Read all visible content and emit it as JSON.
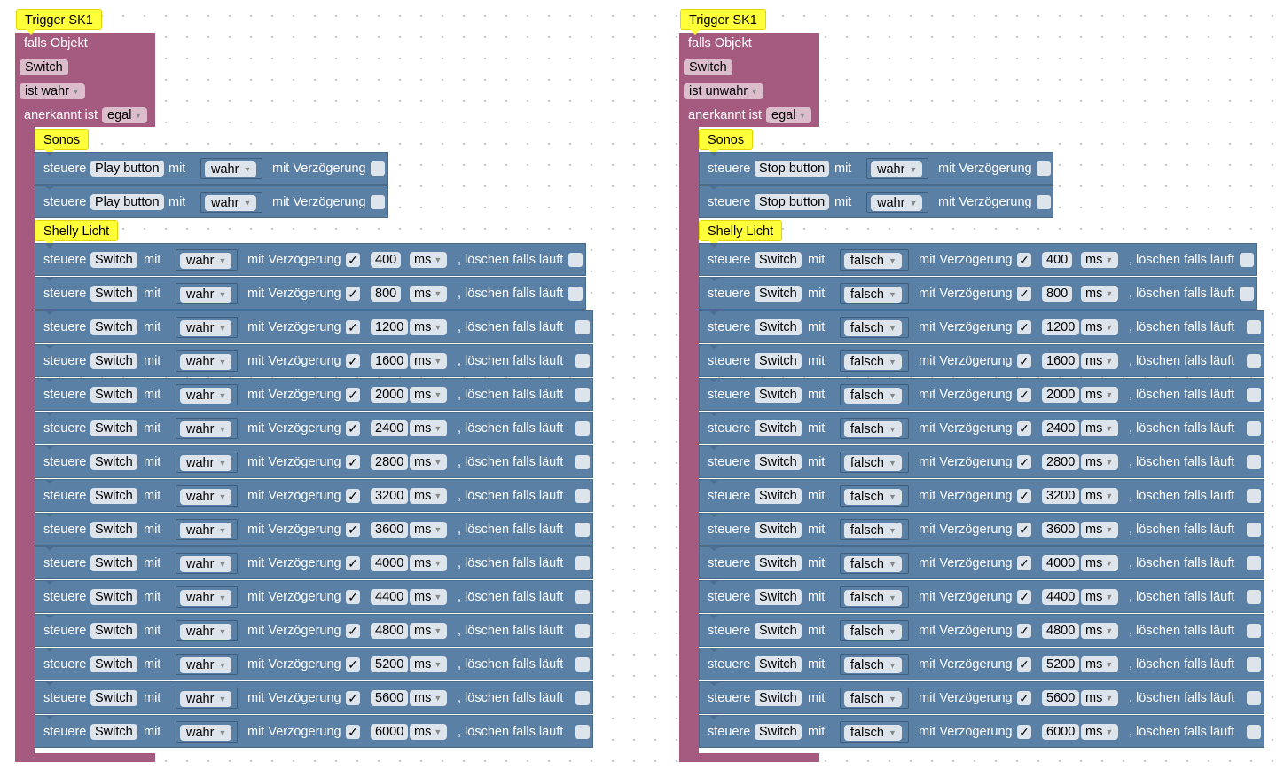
{
  "scripts": [
    {
      "trigger_comment": "Trigger SK1",
      "falls_label": "falls Objekt",
      "object": "Switch",
      "condition": "ist wahr",
      "ack_label": "anerkannt ist",
      "ack_value": "egal",
      "sonos_comment": "Sonos",
      "sonos_blocks": [
        {
          "steuere": "steuere",
          "target": "Play button",
          "mit": "mit",
          "value": "wahr",
          "delay_label": "mit Verzögerung",
          "checked": ""
        },
        {
          "steuere": "steuere",
          "target": "Play button",
          "mit": "mit",
          "value": "wahr",
          "delay_label": "mit Verzögerung",
          "checked": ""
        }
      ],
      "shelly_comment": "Shelly Licht",
      "shelly_blocks": [
        {
          "steuere": "steuere",
          "target": "Switch",
          "mit": "mit",
          "value": "wahr",
          "delay_label": "mit Verzögerung",
          "checked": "✓",
          "delay": "400",
          "unit": "ms",
          "clear_label": ", löschen falls läuft",
          "clear": ""
        },
        {
          "steuere": "steuere",
          "target": "Switch",
          "mit": "mit",
          "value": "wahr",
          "delay_label": "mit Verzögerung",
          "checked": "✓",
          "delay": "800",
          "unit": "ms",
          "clear_label": ", löschen falls läuft",
          "clear": ""
        },
        {
          "steuere": "steuere",
          "target": "Switch",
          "mit": "mit",
          "value": "wahr",
          "delay_label": "mit Verzögerung",
          "checked": "✓",
          "delay": "1200",
          "unit": "ms",
          "clear_label": ", löschen falls läuft",
          "clear": ""
        },
        {
          "steuere": "steuere",
          "target": "Switch",
          "mit": "mit",
          "value": "wahr",
          "delay_label": "mit Verzögerung",
          "checked": "✓",
          "delay": "1600",
          "unit": "ms",
          "clear_label": ", löschen falls läuft",
          "clear": ""
        },
        {
          "steuere": "steuere",
          "target": "Switch",
          "mit": "mit",
          "value": "wahr",
          "delay_label": "mit Verzögerung",
          "checked": "✓",
          "delay": "2000",
          "unit": "ms",
          "clear_label": ", löschen falls läuft",
          "clear": ""
        },
        {
          "steuere": "steuere",
          "target": "Switch",
          "mit": "mit",
          "value": "wahr",
          "delay_label": "mit Verzögerung",
          "checked": "✓",
          "delay": "2400",
          "unit": "ms",
          "clear_label": ", löschen falls läuft",
          "clear": ""
        },
        {
          "steuere": "steuere",
          "target": "Switch",
          "mit": "mit",
          "value": "wahr",
          "delay_label": "mit Verzögerung",
          "checked": "✓",
          "delay": "2800",
          "unit": "ms",
          "clear_label": ", löschen falls läuft",
          "clear": ""
        },
        {
          "steuere": "steuere",
          "target": "Switch",
          "mit": "mit",
          "value": "wahr",
          "delay_label": "mit Verzögerung",
          "checked": "✓",
          "delay": "3200",
          "unit": "ms",
          "clear_label": ", löschen falls läuft",
          "clear": ""
        },
        {
          "steuere": "steuere",
          "target": "Switch",
          "mit": "mit",
          "value": "wahr",
          "delay_label": "mit Verzögerung",
          "checked": "✓",
          "delay": "3600",
          "unit": "ms",
          "clear_label": ", löschen falls läuft",
          "clear": ""
        },
        {
          "steuere": "steuere",
          "target": "Switch",
          "mit": "mit",
          "value": "wahr",
          "delay_label": "mit Verzögerung",
          "checked": "✓",
          "delay": "4000",
          "unit": "ms",
          "clear_label": ", löschen falls läuft",
          "clear": ""
        },
        {
          "steuere": "steuere",
          "target": "Switch",
          "mit": "mit",
          "value": "wahr",
          "delay_label": "mit Verzögerung",
          "checked": "✓",
          "delay": "4400",
          "unit": "ms",
          "clear_label": ", löschen falls läuft",
          "clear": ""
        },
        {
          "steuere": "steuere",
          "target": "Switch",
          "mit": "mit",
          "value": "wahr",
          "delay_label": "mit Verzögerung",
          "checked": "✓",
          "delay": "4800",
          "unit": "ms",
          "clear_label": ", löschen falls läuft",
          "clear": ""
        },
        {
          "steuere": "steuere",
          "target": "Switch",
          "mit": "mit",
          "value": "wahr",
          "delay_label": "mit Verzögerung",
          "checked": "✓",
          "delay": "5200",
          "unit": "ms",
          "clear_label": ", löschen falls läuft",
          "clear": ""
        },
        {
          "steuere": "steuere",
          "target": "Switch",
          "mit": "mit",
          "value": "wahr",
          "delay_label": "mit Verzögerung",
          "checked": "✓",
          "delay": "5600",
          "unit": "ms",
          "clear_label": ", löschen falls läuft",
          "clear": ""
        },
        {
          "steuere": "steuere",
          "target": "Switch",
          "mit": "mit",
          "value": "wahr",
          "delay_label": "mit Verzögerung",
          "checked": "✓",
          "delay": "6000",
          "unit": "ms",
          "clear_label": ", löschen falls läuft",
          "clear": ""
        }
      ]
    },
    {
      "trigger_comment": "Trigger SK1",
      "falls_label": "falls Objekt",
      "object": "Switch",
      "condition": "ist unwahr",
      "ack_label": "anerkannt ist",
      "ack_value": "egal",
      "sonos_comment": "Sonos",
      "sonos_blocks": [
        {
          "steuere": "steuere",
          "target": "Stop button",
          "mit": "mit",
          "value": "wahr",
          "delay_label": "mit Verzögerung",
          "checked": ""
        },
        {
          "steuere": "steuere",
          "target": "Stop button",
          "mit": "mit",
          "value": "wahr",
          "delay_label": "mit Verzögerung",
          "checked": ""
        }
      ],
      "shelly_comment": "Shelly Licht",
      "shelly_blocks": [
        {
          "steuere": "steuere",
          "target": "Switch",
          "mit": "mit",
          "value": "falsch",
          "delay_label": "mit Verzögerung",
          "checked": "✓",
          "delay": "400",
          "unit": "ms",
          "clear_label": ", löschen falls läuft",
          "clear": ""
        },
        {
          "steuere": "steuere",
          "target": "Switch",
          "mit": "mit",
          "value": "falsch",
          "delay_label": "mit Verzögerung",
          "checked": "✓",
          "delay": "800",
          "unit": "ms",
          "clear_label": ", löschen falls läuft",
          "clear": ""
        },
        {
          "steuere": "steuere",
          "target": "Switch",
          "mit": "mit",
          "value": "falsch",
          "delay_label": "mit Verzögerung",
          "checked": "✓",
          "delay": "1200",
          "unit": "ms",
          "clear_label": ", löschen falls läuft",
          "clear": ""
        },
        {
          "steuere": "steuere",
          "target": "Switch",
          "mit": "mit",
          "value": "falsch",
          "delay_label": "mit Verzögerung",
          "checked": "✓",
          "delay": "1600",
          "unit": "ms",
          "clear_label": ", löschen falls läuft",
          "clear": ""
        },
        {
          "steuere": "steuere",
          "target": "Switch",
          "mit": "mit",
          "value": "falsch",
          "delay_label": "mit Verzögerung",
          "checked": "✓",
          "delay": "2000",
          "unit": "ms",
          "clear_label": ", löschen falls läuft",
          "clear": ""
        },
        {
          "steuere": "steuere",
          "target": "Switch",
          "mit": "mit",
          "value": "falsch",
          "delay_label": "mit Verzögerung",
          "checked": "✓",
          "delay": "2400",
          "unit": "ms",
          "clear_label": ", löschen falls läuft",
          "clear": ""
        },
        {
          "steuere": "steuere",
          "target": "Switch",
          "mit": "mit",
          "value": "falsch",
          "delay_label": "mit Verzögerung",
          "checked": "✓",
          "delay": "2800",
          "unit": "ms",
          "clear_label": ", löschen falls läuft",
          "clear": ""
        },
        {
          "steuere": "steuere",
          "target": "Switch",
          "mit": "mit",
          "value": "falsch",
          "delay_label": "mit Verzögerung",
          "checked": "✓",
          "delay": "3200",
          "unit": "ms",
          "clear_label": ", löschen falls läuft",
          "clear": ""
        },
        {
          "steuere": "steuere",
          "target": "Switch",
          "mit": "mit",
          "value": "falsch",
          "delay_label": "mit Verzögerung",
          "checked": "✓",
          "delay": "3600",
          "unit": "ms",
          "clear_label": ", löschen falls läuft",
          "clear": ""
        },
        {
          "steuere": "steuere",
          "target": "Switch",
          "mit": "mit",
          "value": "falsch",
          "delay_label": "mit Verzögerung",
          "checked": "✓",
          "delay": "4000",
          "unit": "ms",
          "clear_label": ", löschen falls läuft",
          "clear": ""
        },
        {
          "steuere": "steuere",
          "target": "Switch",
          "mit": "mit",
          "value": "falsch",
          "delay_label": "mit Verzögerung",
          "checked": "✓",
          "delay": "4400",
          "unit": "ms",
          "clear_label": ", löschen falls läuft",
          "clear": ""
        },
        {
          "steuere": "steuere",
          "target": "Switch",
          "mit": "mit",
          "value": "falsch",
          "delay_label": "mit Verzögerung",
          "checked": "✓",
          "delay": "4800",
          "unit": "ms",
          "clear_label": ", löschen falls läuft",
          "clear": ""
        },
        {
          "steuere": "steuere",
          "target": "Switch",
          "mit": "mit",
          "value": "falsch",
          "delay_label": "mit Verzögerung",
          "checked": "✓",
          "delay": "5200",
          "unit": "ms",
          "clear_label": ", löschen falls läuft",
          "clear": ""
        },
        {
          "steuere": "steuere",
          "target": "Switch",
          "mit": "mit",
          "value": "falsch",
          "delay_label": "mit Verzögerung",
          "checked": "✓",
          "delay": "5600",
          "unit": "ms",
          "clear_label": ", löschen falls läuft",
          "clear": ""
        },
        {
          "steuere": "steuere",
          "target": "Switch",
          "mit": "mit",
          "value": "falsch",
          "delay_label": "mit Verzögerung",
          "checked": "✓",
          "delay": "6000",
          "unit": "ms",
          "clear_label": ", löschen falls läuft",
          "clear": ""
        }
      ]
    }
  ]
}
